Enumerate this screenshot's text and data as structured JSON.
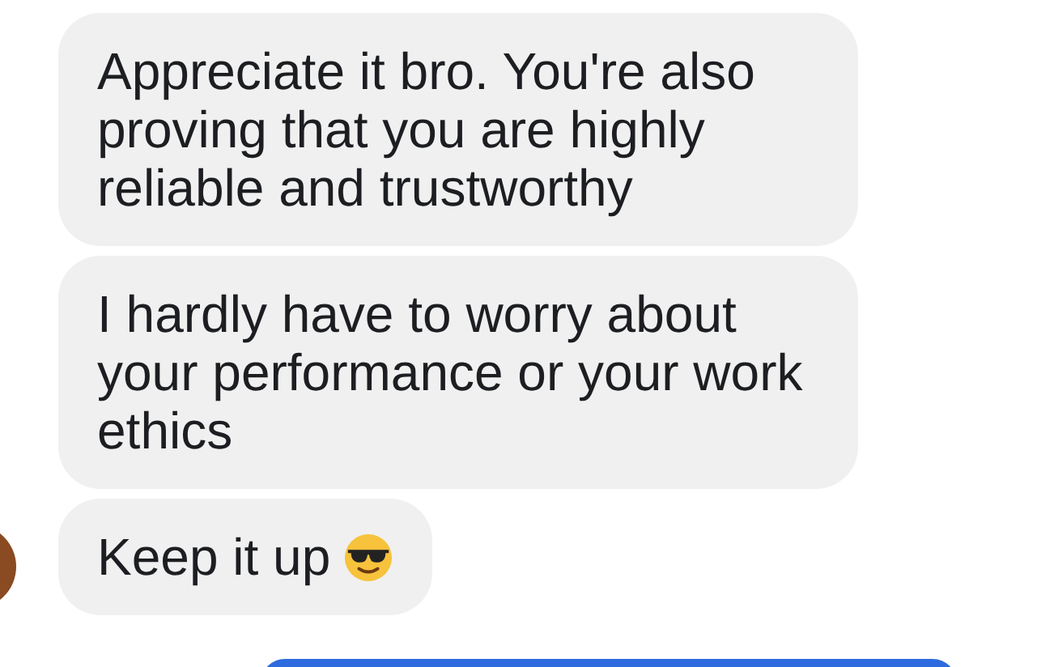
{
  "messages": [
    {
      "outgoing": false,
      "kind": "text",
      "text": "Appreciate it bro. You're also proving that you are highly reliable and trustworthy",
      "avatar": false
    },
    {
      "outgoing": false,
      "kind": "text",
      "text": "I hardly have to worry about your performance or your work ethics",
      "avatar": false
    },
    {
      "outgoing": false,
      "kind": "text_with_cool_emoji",
      "text": "Keep it up",
      "avatar": true
    },
    {
      "outgoing": true,
      "kind": "cut_off"
    }
  ]
}
